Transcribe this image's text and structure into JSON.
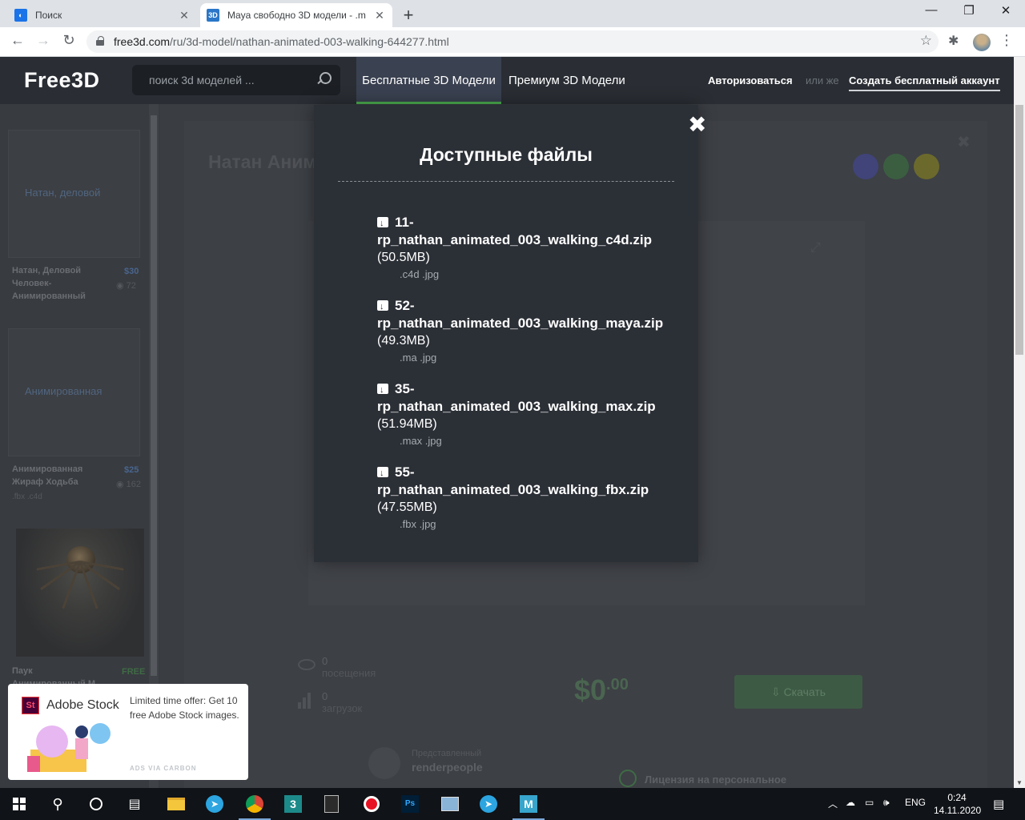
{
  "browser": {
    "tabs": [
      {
        "title": "Поиск",
        "icon": "search-favicon"
      },
      {
        "title": "Maya свободно 3D модели - .m",
        "icon": "3d-favicon",
        "fav_text": "3D"
      }
    ],
    "url_host": "free3d.com",
    "url_path": "/ru/3d-model/nathan-animated-003-walking-644277.html"
  },
  "site": {
    "logo": "Free3D",
    "search_placeholder": "поиск 3d моделей ...",
    "nav": {
      "free": "Бесплатные 3D Модели",
      "premium": "Премиум 3D Модели"
    },
    "login": "Авторизоваться",
    "or": "или же",
    "signup": "Создать бесплатный аккаунт"
  },
  "sidebar": {
    "cards": [
      {
        "alt": "Натан, деловой",
        "name": "Натан, Деловой Человек-Анимированный",
        "price": "$30",
        "views": "72",
        "formats": ""
      },
      {
        "alt": "Анимированная",
        "name": "Анимированная Жираф Ходьба",
        "price": "$25",
        "views": "162",
        "formats": ".fbx .c4d"
      },
      {
        "alt": "",
        "name": "Паук Анимированный М",
        "price": "FREE",
        "views": "",
        "formats": ""
      }
    ]
  },
  "main": {
    "title": "Натан Аним",
    "views_count": "0",
    "views_label": "посещения",
    "downloads_count": "0",
    "downloads_label": "загрузок",
    "price_main": "$0",
    "price_cents": ".00",
    "download_button": "Скачать",
    "author_label": "Представленный",
    "author_name": "renderpeople",
    "license": "Лицензия на персональное",
    "circle_colors": [
      "#4a4f9a",
      "#3f6b45",
      "#7a7a2a"
    ]
  },
  "modal": {
    "title": "Доступные файлы",
    "files": [
      {
        "name_line1": "11-",
        "name_line2": "rp_nathan_animated_003_walking_c4d.zip",
        "size": "(50.5MB)",
        "ext": ".c4d .jpg"
      },
      {
        "name_line1": "52-",
        "name_line2": "rp_nathan_animated_003_walking_maya.zip",
        "size": "(49.3MB)",
        "ext": ".ma .jpg"
      },
      {
        "name_line1": "35-",
        "name_line2": "rp_nathan_animated_003_walking_max.zip",
        "size": "(51.94MB)",
        "ext": ".max .jpg"
      },
      {
        "name_line1": "55-",
        "name_line2": "rp_nathan_animated_003_walking_fbx.zip",
        "size": "(47.55MB)",
        "ext": ".fbx .jpg"
      }
    ]
  },
  "ad": {
    "brand": "Adobe Stock",
    "logo_text": "St",
    "offer": "Limited time offer: Get 10 free Adobe Stock images.",
    "via": "ADS VIA CARBON"
  },
  "help": "?",
  "taskbar": {
    "lang": "ENG",
    "time": "0:24",
    "date": "14.11.2020"
  }
}
